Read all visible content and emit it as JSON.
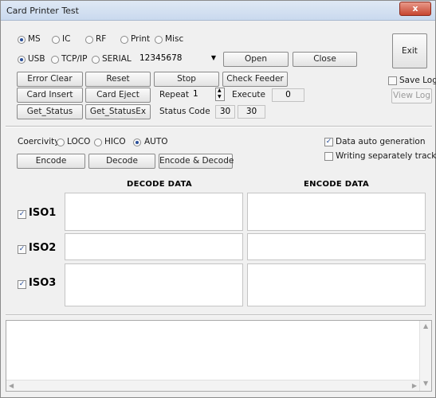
{
  "window": {
    "title": "Card Printer Test",
    "close_glyph": "x"
  },
  "mode_radios": [
    {
      "label": "MS",
      "selected": true
    },
    {
      "label": "IC",
      "selected": false
    },
    {
      "label": "RF",
      "selected": false
    },
    {
      "label": "Print",
      "selected": false
    },
    {
      "label": "Misc",
      "selected": false
    }
  ],
  "conn_radios": [
    {
      "label": "USB",
      "selected": true
    },
    {
      "label": "TCP/IP",
      "selected": false
    },
    {
      "label": "SERIAL",
      "selected": false
    }
  ],
  "port_value": "12345678",
  "buttons": {
    "open": "Open",
    "close": "Close",
    "exit": "Exit",
    "error_clear": "Error Clear",
    "reset": "Reset",
    "stop": "Stop",
    "check_feeder": "Check Feeder",
    "card_insert": "Card Insert",
    "card_eject": "Card Eject",
    "get_status": "Get_Status",
    "get_status_ex": "Get_StatusEx",
    "view_log": "View Log",
    "encode": "Encode",
    "decode": "Decode",
    "encode_decode": "Encode & Decode"
  },
  "repeat": {
    "label": "Repeat",
    "value": "1"
  },
  "execute": {
    "label": "Execute",
    "value": "0"
  },
  "status_code": {
    "label": "Status Code",
    "value1": "30",
    "value2": "30"
  },
  "save_log": {
    "label": "Save Log",
    "checked": false
  },
  "coercivity": {
    "label": "Coercivity",
    "options": [
      {
        "label": "LOCO",
        "selected": false
      },
      {
        "label": "HICO",
        "selected": false
      },
      {
        "label": "AUTO",
        "selected": true
      }
    ]
  },
  "data_auto_generation": {
    "label": "Data auto generation",
    "checked": true
  },
  "writing_separately": {
    "label": "Writing separately track",
    "checked": false
  },
  "headers": {
    "decode": "DECODE DATA",
    "encode": "ENCODE DATA"
  },
  "tracks": [
    {
      "label": "ISO1",
      "checked": true
    },
    {
      "label": "ISO2",
      "checked": true
    },
    {
      "label": "ISO3",
      "checked": true
    }
  ],
  "check_glyph": "✓"
}
